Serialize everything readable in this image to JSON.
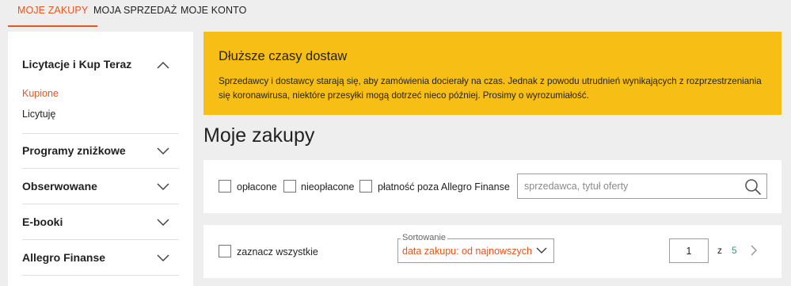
{
  "tabs": [
    {
      "label": "MOJE ZAKUPY",
      "active": true
    },
    {
      "label": "MOJA SPRZEDAŻ",
      "active": false
    },
    {
      "label": "MOJE KONTO",
      "active": false
    }
  ],
  "sidebar": {
    "sections": [
      {
        "title": "Licytacje i Kup Teraz",
        "expanded": true,
        "items": [
          {
            "label": "Kupione",
            "active": true
          },
          {
            "label": "Licytuję",
            "active": false
          }
        ]
      },
      {
        "title": "Programy zniżkowe",
        "expanded": false
      },
      {
        "title": "Obserwowane",
        "expanded": false
      },
      {
        "title": "E-booki",
        "expanded": false
      },
      {
        "title": "Allegro Finanse",
        "expanded": false
      }
    ]
  },
  "banner": {
    "title": "Dłuższe czasy dostaw",
    "text": "Sprzedawcy i dostawcy starają się, aby zamówienia docierały na czas. Jednak z powodu utrudnień wynikających z rozprzestrzeniania się koronawirusa, niektóre przesyłki mogą dotrzeć nieco później. Prosimy o wyrozumiałość."
  },
  "page_title": "Moje zakupy",
  "filters": {
    "checkboxes": [
      "opłacone",
      "nieopłacone",
      "płatność poza Allegro Finanse"
    ],
    "search_placeholder": "sprzedawca, tytuł oferty"
  },
  "list": {
    "select_all_label": "zaznacz wszystkie",
    "sort_label": "Sortowanie",
    "sort_value": "data zakupu: od najnowszych",
    "page_current": "1",
    "page_of": "z",
    "page_total": "5"
  },
  "colors": {
    "accent": "#e8551c",
    "banner": "#f7bf15",
    "link_green": "#20a38e"
  },
  "icons": {
    "search": "search-icon",
    "chevron_up": "chevron-up-icon",
    "chevron_down": "chevron-down-icon",
    "next": "chevron-right-icon"
  }
}
